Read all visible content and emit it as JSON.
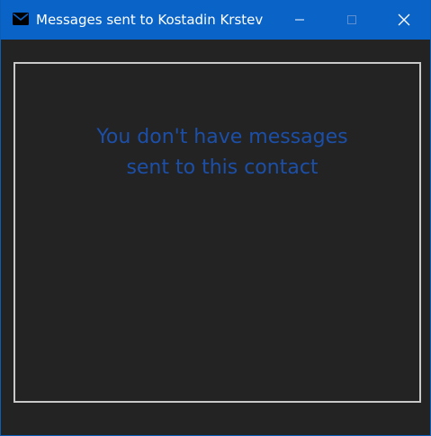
{
  "window": {
    "title": "Messages sent to Kostadin Krstev",
    "icon": "mail-icon",
    "controls": {
      "minimize_icon": "minimize-icon",
      "maximize_icon": "maximize-icon",
      "close_icon": "close-icon"
    }
  },
  "main": {
    "empty_message": "You don't have messages\nsent to this contact"
  },
  "colors": {
    "titlebar": "#0a64c8",
    "background": "#232323",
    "message_text": "#1c4fa8",
    "box_border": "#c9c9c9"
  }
}
